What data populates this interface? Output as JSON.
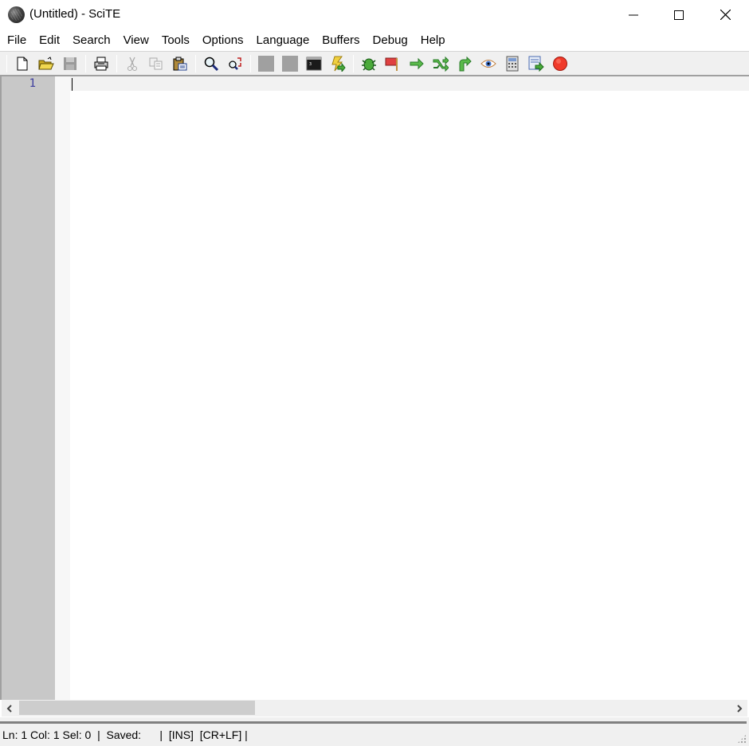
{
  "window": {
    "title": "(Untitled) - SciTE",
    "app_icon": "scite-globe-icon",
    "controls": [
      "minimize",
      "maximize",
      "close"
    ]
  },
  "menubar": {
    "items": [
      {
        "label": "File"
      },
      {
        "label": "Edit"
      },
      {
        "label": "Search"
      },
      {
        "label": "View"
      },
      {
        "label": "Tools"
      },
      {
        "label": "Options"
      },
      {
        "label": "Language"
      },
      {
        "label": "Buffers"
      },
      {
        "label": "Debug"
      },
      {
        "label": "Help"
      }
    ]
  },
  "toolbar": {
    "groups": [
      [
        {
          "icon": "new-file-icon"
        },
        {
          "icon": "open-folder-icon"
        },
        {
          "icon": "save-icon",
          "disabled": true
        }
      ],
      [
        {
          "icon": "print-icon"
        }
      ],
      [
        {
          "icon": "cut-icon",
          "disabled": true
        },
        {
          "icon": "copy-icon",
          "disabled": true
        },
        {
          "icon": "paste-icon"
        }
      ],
      [
        {
          "icon": "find-icon"
        },
        {
          "icon": "replace-icon"
        }
      ],
      [
        {
          "icon": "blank-tool-1-icon"
        },
        {
          "icon": "blank-tool-2-icon"
        },
        {
          "icon": "terminal-icon"
        },
        {
          "icon": "run-macro-icon"
        }
      ],
      [
        {
          "icon": "debug-bug-icon"
        },
        {
          "icon": "breakpoint-flag-icon"
        },
        {
          "icon": "step-arrow-icon"
        },
        {
          "icon": "step-over-icon"
        },
        {
          "icon": "step-out-icon"
        },
        {
          "icon": "watch-eye-icon"
        },
        {
          "icon": "calculator-icon"
        },
        {
          "icon": "export-icon"
        },
        {
          "icon": "stop-icon"
        }
      ]
    ]
  },
  "editor": {
    "line_numbers": [
      "1"
    ],
    "content": ""
  },
  "scrollbar": {
    "left_arrow": "<",
    "right_arrow": ">"
  },
  "statusbar": {
    "text": "Ln: 1 Col: 1 Sel: 0  |  Saved:      |  [INS]  [CR+LF] |"
  },
  "colors": {
    "gutter": "#c8c8c8",
    "line_number": "#3d3d9e",
    "caret_line": "#f2f2f2"
  }
}
